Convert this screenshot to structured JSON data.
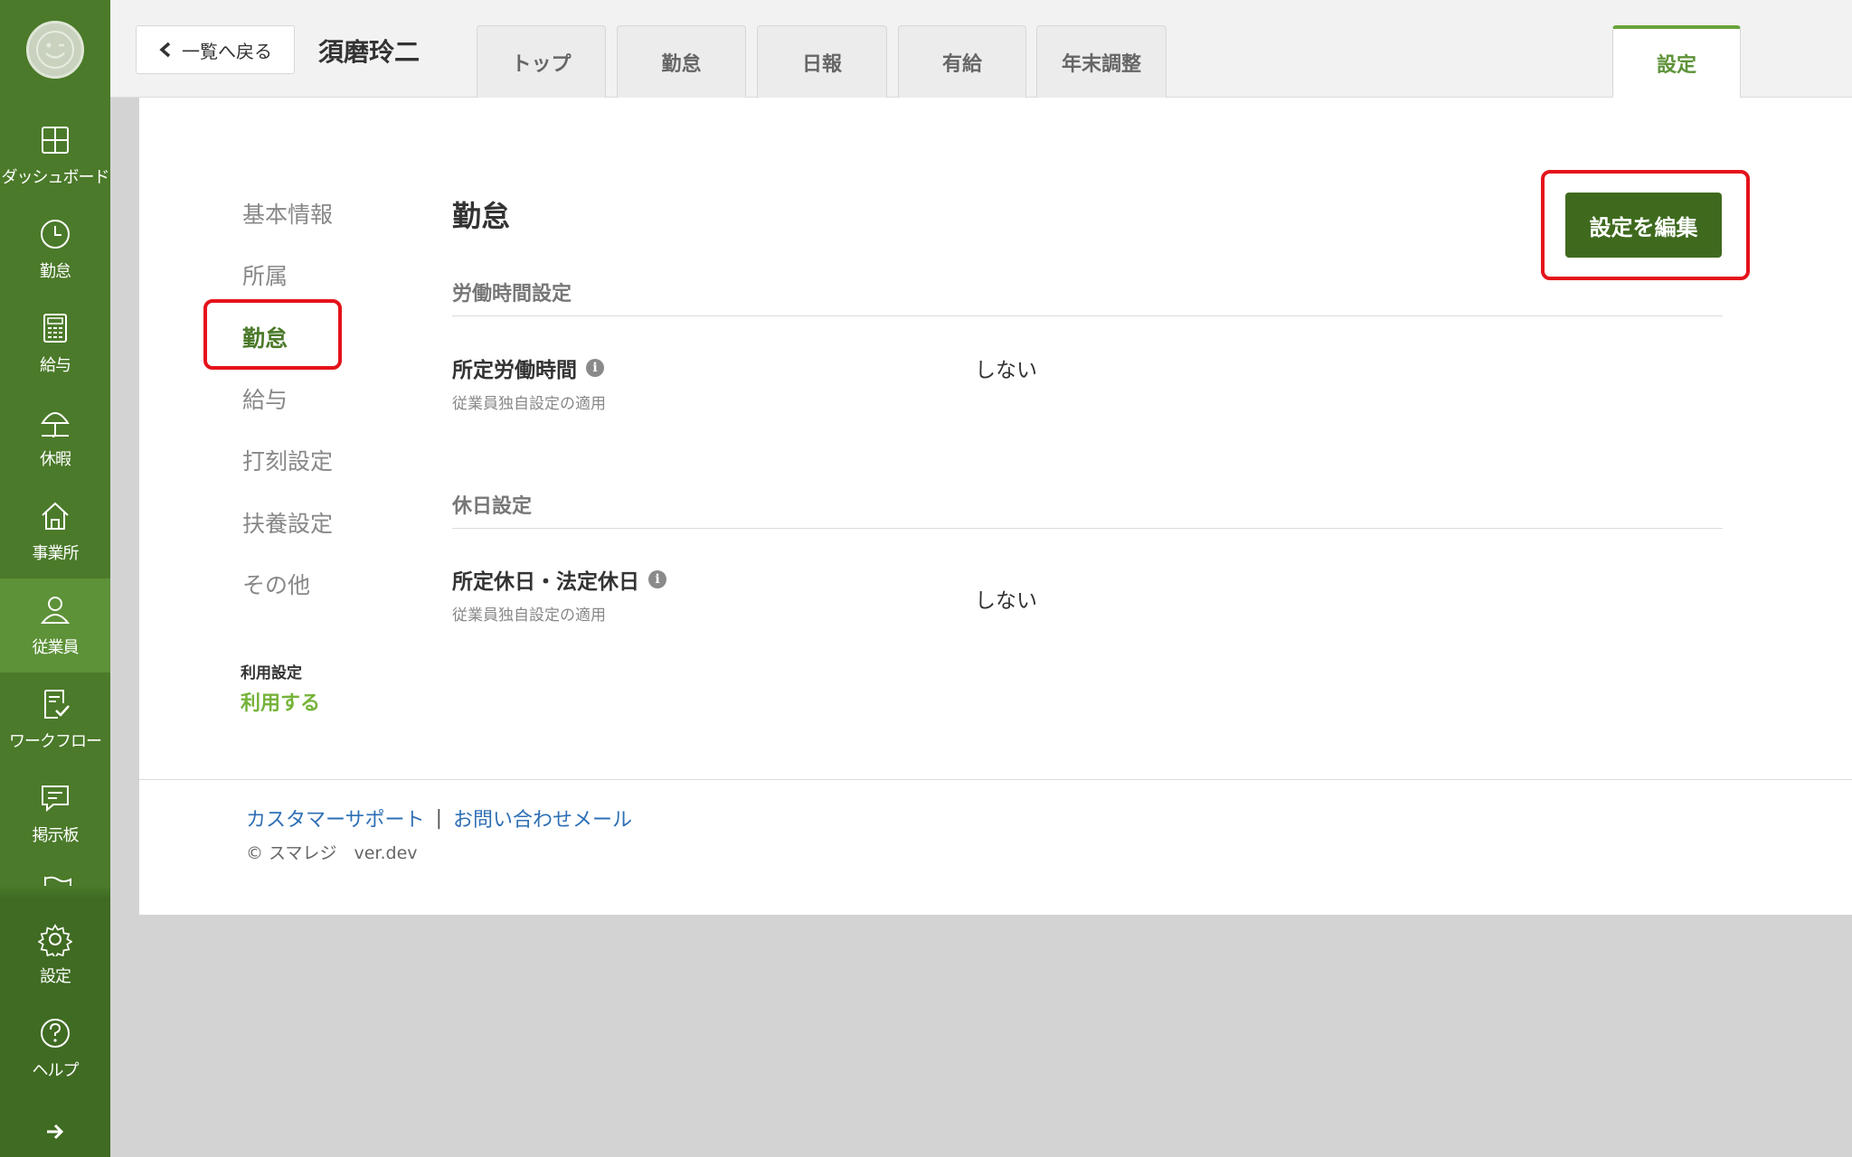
{
  "sidebar": {
    "items": [
      {
        "label": "ダッシュボード",
        "icon": "dashboard-icon"
      },
      {
        "label": "勤怠",
        "icon": "clock-icon"
      },
      {
        "label": "給与",
        "icon": "calculator-icon"
      },
      {
        "label": "休暇",
        "icon": "umbrella-icon"
      },
      {
        "label": "事業所",
        "icon": "home-icon"
      },
      {
        "label": "従業員",
        "icon": "person-icon"
      },
      {
        "label": "ワークフロー",
        "icon": "workflow-icon"
      },
      {
        "label": "掲示板",
        "icon": "message-icon"
      },
      {
        "label": "",
        "icon": "flag-icon"
      },
      {
        "label": "設定",
        "icon": "gear-icon"
      },
      {
        "label": "ヘルプ",
        "icon": "help-icon"
      }
    ],
    "active": "従業員",
    "expand_icon": "arrow-right-icon"
  },
  "header": {
    "back_label": "一覧へ戻る",
    "employee_name": "須磨玲二",
    "tabs": [
      {
        "label": "トップ"
      },
      {
        "label": "勤怠"
      },
      {
        "label": "日報"
      },
      {
        "label": "有給"
      },
      {
        "label": "年末調整"
      },
      {
        "label": "設定"
      }
    ],
    "active_tab": "設定"
  },
  "subnav": {
    "items": [
      "基本情報",
      "所属",
      "勤怠",
      "給与",
      "打刻設定",
      "扶養設定",
      "その他"
    ],
    "active": "勤怠",
    "usage_label": "利用設定",
    "usage_value": "利用する"
  },
  "main": {
    "title": "勤怠",
    "edit_button": "設定を編集",
    "groups": [
      {
        "title": "労働時間設定",
        "rows": [
          {
            "label": "所定労働時間",
            "sub": "従業員独自設定の適用",
            "value": "しない"
          }
        ]
      },
      {
        "title": "休日設定",
        "rows": [
          {
            "label": "所定休日・法定休日",
            "sub": "従業員独自設定の適用",
            "value": "しない"
          }
        ]
      }
    ]
  },
  "footer": {
    "link_support": "カスタマーサポート",
    "separator": "|",
    "link_mail": "お問い合わせメール",
    "copyright": "© スマレジ　ver.dev"
  },
  "colors": {
    "sidebar": "#4b7a2a",
    "sidebar_active": "#5d9238",
    "accent_button": "#3f6a1e",
    "highlight": "#e5131b",
    "link": "#2e6fb5",
    "usage_value": "#76b33a"
  }
}
